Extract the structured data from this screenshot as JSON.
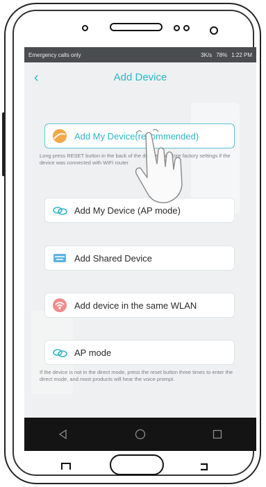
{
  "status_bar": {
    "left_text": "Emergency calls only",
    "right_text": "3K/s",
    "battery": "78%",
    "time": "1:22 PM"
  },
  "header": {
    "title": "Add Device"
  },
  "options": [
    {
      "label": "Add My Device(recommended)",
      "icon": "device-icon"
    },
    {
      "label": "Add My Device (AP mode)",
      "icon": "link-icon"
    },
    {
      "label": "Add Shared Device",
      "icon": "keyboard-icon"
    },
    {
      "label": "Add device in the same WLAN",
      "icon": "wifi-icon"
    },
    {
      "label": "AP mode",
      "icon": "link-icon"
    }
  ],
  "hints": {
    "primary": "Long press RESET button in the back of the device to restore factory settings if the device was connected with WiFi router",
    "ap_mode": "If the device is not in the direct mode, press the reset button three times to enter the direct mode, and most products will hear the voice prompt."
  },
  "colors": {
    "accent": "#2fb5c6",
    "status_bar": "#4a4d50",
    "nav_bar": "#141414"
  }
}
